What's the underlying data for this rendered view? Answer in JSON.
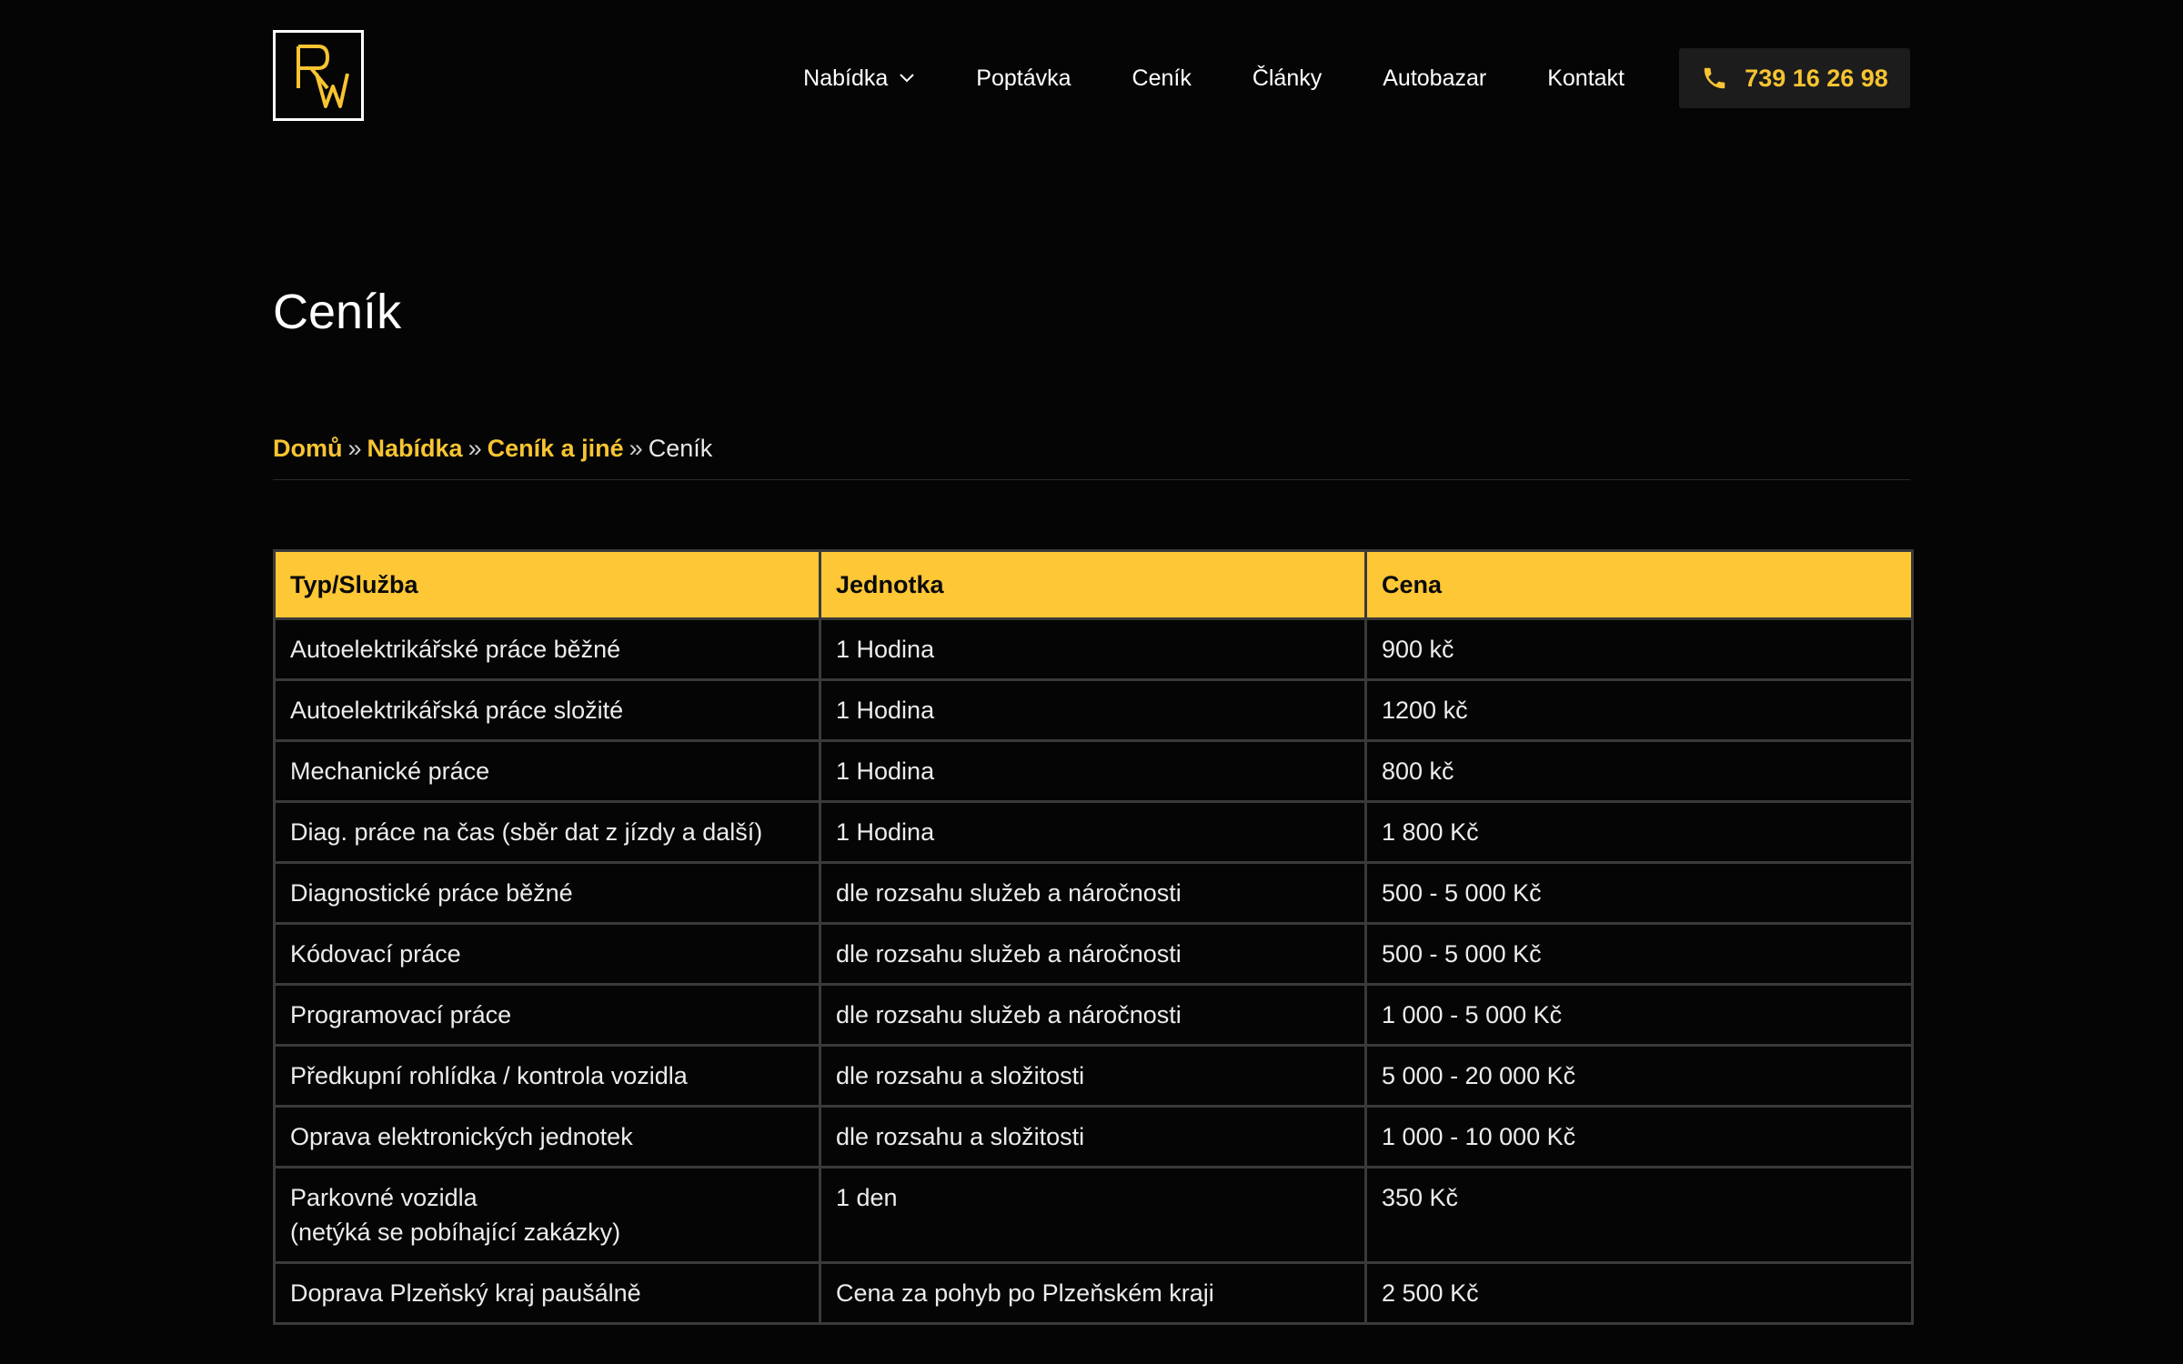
{
  "brand": {
    "logo_text": "RW",
    "accent_color": "#f7c432",
    "header_color": "#fdc735"
  },
  "nav": {
    "items": [
      {
        "label": "Nabídka",
        "has_dropdown": true
      },
      {
        "label": "Poptávka"
      },
      {
        "label": "Ceník"
      },
      {
        "label": "Články"
      },
      {
        "label": "Autobazar"
      },
      {
        "label": "Kontakt"
      }
    ],
    "phone": "739 16 26 98",
    "phone_icon": "phone-icon"
  },
  "page": {
    "title": "Ceník"
  },
  "breadcrumb": {
    "items": [
      "Domů",
      "Nabídka",
      "Ceník a jiné"
    ],
    "current": "Ceník",
    "separator": "»"
  },
  "table": {
    "headers": [
      "Typ/Služba",
      "Jednotka",
      "Cena"
    ],
    "rows": [
      {
        "service": "Autoelektrikářské práce běžné",
        "unit": "1 Hodina",
        "price": "900 kč"
      },
      {
        "service": "Autoelektrikářská práce složité",
        "unit": "1 Hodina",
        "price": "1200 kč"
      },
      {
        "service": "Mechanické práce",
        "unit": "1 Hodina",
        "price": "800 kč"
      },
      {
        "service": "Diag. práce na čas (sběr dat z jízdy a další)",
        "unit": "1 Hodina",
        "price": "1 800 Kč"
      },
      {
        "service": "Diagnostické práce běžné",
        "unit": "dle rozsahu služeb a náročnosti",
        "price": "500 - 5 000 Kč"
      },
      {
        "service": "Kódovací práce",
        "unit": "dle rozsahu služeb a náročnosti",
        "price": "500 - 5 000 Kč"
      },
      {
        "service": "Programovací práce",
        "unit": "dle rozsahu služeb a náročnosti",
        "price": "1 000 - 5 000 Kč"
      },
      {
        "service": "Předkupní rohlídka / kontrola vozidla",
        "unit": "dle rozsahu a složitosti",
        "price": "5 000 - 20 000 Kč"
      },
      {
        "service": "Oprava elektronických jednotek",
        "unit": "dle rozsahu a složitosti",
        "price": "1 000 - 10 000 Kč"
      },
      {
        "service": "Parkovné vozidla",
        "service_line2": "(netýká se pobíhající zakázky)",
        "unit": "1 den",
        "price": "350 Kč"
      },
      {
        "service": "Doprava Plzeňský kraj paušálně",
        "unit": "Cena za pohyb po Plzeňském kraji",
        "price": "2 500 Kč"
      }
    ]
  }
}
